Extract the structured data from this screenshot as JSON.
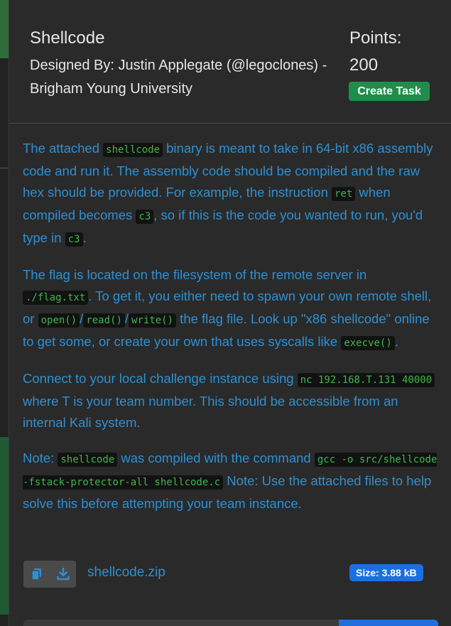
{
  "modal": {
    "title": "Shellcode",
    "designer": "Designed By: Justin Applegate (@legoclones) - Brigham Young University",
    "points_label": "Points:",
    "points_value": "200",
    "create_task_label": "Create Task"
  },
  "description": {
    "p1": {
      "t1": "The attached ",
      "c1": "shellcode",
      "t2": " binary is meant to take in 64-bit x86 assembly code and run it. The assembly code should be compiled and the raw hex should be provided. For example, the instruction ",
      "c2": "ret",
      "t3": " when compiled becomes ",
      "c3": "c3",
      "t4": ", so if this is the code you wanted to run, you'd type in ",
      "c4": "c3",
      "t5": "."
    },
    "p2": {
      "t1": "The flag is located on the filesystem of the remote server in ",
      "c1": "./flag.txt",
      "t2": ". To get it, you either need to spawn your own remote shell, or ",
      "c2": "open()",
      "s1": "/",
      "c3": "read()",
      "s2": "/",
      "c4": "write()",
      "t3": " the flag file. Look up \"x86 shellcode\" online to get some, or create your own that uses syscalls like ",
      "c5": "execve()",
      "t4": "."
    },
    "p3": {
      "t1": "Connect to your local challenge instance using ",
      "c1": "nc 192.168.T.131 40000",
      "t2": " where T is your team number. This should be accessible from an internal Kali system."
    },
    "p4": {
      "t1": "Note: ",
      "c1": "shellcode",
      "t2": " was compiled with the command ",
      "c2": "gcc -o src/shellcode -fstack-protector-all shellcode.c",
      "t3": " Note: Use the attached files to help solve this before attempting your team instance."
    }
  },
  "attachment": {
    "copy_icon": "copy-icon",
    "download_icon": "download-icon",
    "filename": "shellcode.zip",
    "size": "Size: 3.88 kB"
  },
  "colors": {
    "accent_blue": "#2e8fd1",
    "code_green": "#3fb64a",
    "create_green": "#1f8e4a",
    "badge_blue": "#1d6fe0"
  }
}
